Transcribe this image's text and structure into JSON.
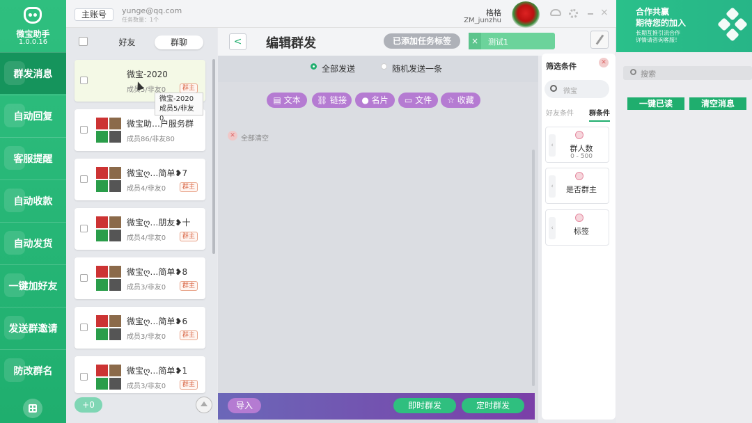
{
  "app": {
    "name": "微宝助手",
    "version": "1.0.0.16"
  },
  "nav": {
    "items": [
      "群发消息",
      "自动回复",
      "客服提醒",
      "自动收款",
      "自动发货",
      "一键加好友",
      "发送群邀请",
      "防改群名"
    ],
    "active_index": 0
  },
  "topbar": {
    "account_badge": "主账号",
    "email": "yunge@qq.com",
    "task_text": "任务数量：1个",
    "user_name": "格格",
    "user_id": "ZM_junzhu"
  },
  "ad": {
    "line1": "合作共赢",
    "line2": "期待您的加入",
    "line3": "长期互推引流合作",
    "line4": "详情请咨询客服！"
  },
  "right_panel": {
    "search_placeholder": "搜索",
    "mark_read": "一键已读",
    "clear_messages": "清空消息"
  },
  "list": {
    "tab_friends": "好友",
    "tab_groups": "群聊",
    "tooltip_name": "微宝-2020",
    "tooltip_members": "成员5/非友0",
    "add_count": "+0",
    "groups": [
      {
        "name": "微宝-2020",
        "members": "成员5/非友0",
        "badge": "群主",
        "avatar": false,
        "selected": true
      },
      {
        "name": "微宝助…户服务群",
        "members": "成员86/非友80",
        "badge": "",
        "avatar": true,
        "selected": false
      },
      {
        "name": "微宝ღ…简单❥7",
        "members": "成员4/非友0",
        "badge": "群主",
        "avatar": true,
        "selected": false
      },
      {
        "name": "微宝ღ…朋友❥十",
        "members": "成员4/非友0",
        "badge": "群主",
        "avatar": true,
        "selected": false
      },
      {
        "name": "微宝ღ…简单❥8",
        "members": "成员3/非友0",
        "badge": "群主",
        "avatar": true,
        "selected": false
      },
      {
        "name": "微宝ღ…简单❥6",
        "members": "成员3/非友0",
        "badge": "群主",
        "avatar": true,
        "selected": false
      },
      {
        "name": "微宝ღ…简单❥1",
        "members": "成员3/非友0",
        "badge": "群主",
        "avatar": true,
        "selected": false
      }
    ]
  },
  "editor": {
    "back": "<",
    "title": "编辑群发",
    "tag_button": "已添加任务标签",
    "tag_chip": "测试1",
    "tag_chip_close": "×",
    "mode_all": "全部发送",
    "mode_random": "随机发送一条",
    "tools": [
      "文本",
      "链接",
      "名片",
      "文件",
      "收藏"
    ],
    "clear_all": "全部清空",
    "import": "导入",
    "send_now": "即时群发",
    "send_timed": "定时群发"
  },
  "filter": {
    "title": "筛选条件",
    "search_placeholder": "微宝",
    "tab_friend": "好友条件",
    "tab_group": "群条件",
    "cards": [
      {
        "label": "群人数",
        "sub": "0   -  500"
      },
      {
        "label": "是否群主",
        "sub": ""
      },
      {
        "label": "标签",
        "sub": ""
      }
    ]
  },
  "colors": {
    "brand": "#1fae6e",
    "purple": "#b57bd2",
    "badge": "#d96a4a"
  }
}
